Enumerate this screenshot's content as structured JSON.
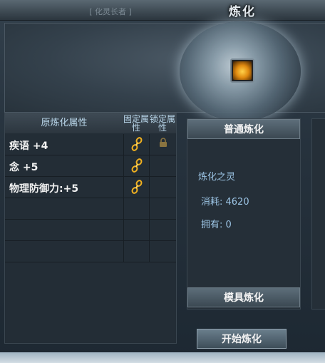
{
  "window": {
    "title": "炼化",
    "subtitle": "[ 化灵长者 ]"
  },
  "attr_table": {
    "header_attr": "原炼化属性",
    "header_fixed": "固定属性",
    "header_lock": "锁定属性",
    "rows": [
      {
        "name": "疾语 +4"
      },
      {
        "name": "念 +5"
      },
      {
        "name": "物理防御力:+5"
      }
    ]
  },
  "right_panel": {
    "tab_normal": "普通炼化",
    "spirit_label": "炼化之灵",
    "cost_text": "消耗: 4620",
    "own_text": "拥有: 0",
    "tab_mold": "模具炼化"
  },
  "start_button": "开始炼化",
  "colors": {
    "accent_text": "#9cc4e4",
    "header_text": "#b9d6ea"
  }
}
